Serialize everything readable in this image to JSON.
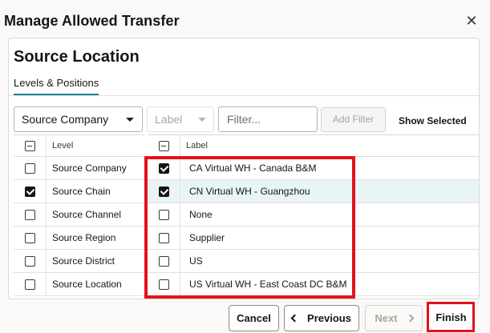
{
  "dialog": {
    "title": "Manage Allowed Transfer",
    "close_glyph": "✕"
  },
  "section": {
    "title": "Source Location",
    "tab": "Levels & Positions"
  },
  "toolbar": {
    "level_select": "Source Company",
    "label_select": "Label",
    "filter_placeholder": "Filter...",
    "add_filter": "Add Filter",
    "show_selected": "Show Selected"
  },
  "levels_table": {
    "header": "Level",
    "rows": [
      {
        "label": "Source Company",
        "checked": false
      },
      {
        "label": "Source Chain",
        "checked": true
      },
      {
        "label": "Source Channel",
        "checked": false
      },
      {
        "label": "Source Region",
        "checked": false
      },
      {
        "label": "Source District",
        "checked": false
      },
      {
        "label": "Source Location",
        "checked": false
      }
    ]
  },
  "labels_table": {
    "header": "Label",
    "rows": [
      {
        "label": "CA Virtual WH - Canada B&M",
        "checked": true,
        "selected": false
      },
      {
        "label": "CN Virtual WH - Guangzhou",
        "checked": true,
        "selected": true
      },
      {
        "label": "None",
        "checked": false,
        "selected": false
      },
      {
        "label": "Supplier",
        "checked": false,
        "selected": false
      },
      {
        "label": "US",
        "checked": false,
        "selected": false
      },
      {
        "label": "US Virtual WH - East Coast DC B&M",
        "checked": false,
        "selected": false
      }
    ]
  },
  "footer": {
    "cancel": "Cancel",
    "previous": "Previous",
    "next": "Next",
    "finish": "Finish"
  },
  "colors": {
    "accent": "#227e9e",
    "highlight": "#e3121b",
    "selected_row": "#e9f4f7"
  }
}
